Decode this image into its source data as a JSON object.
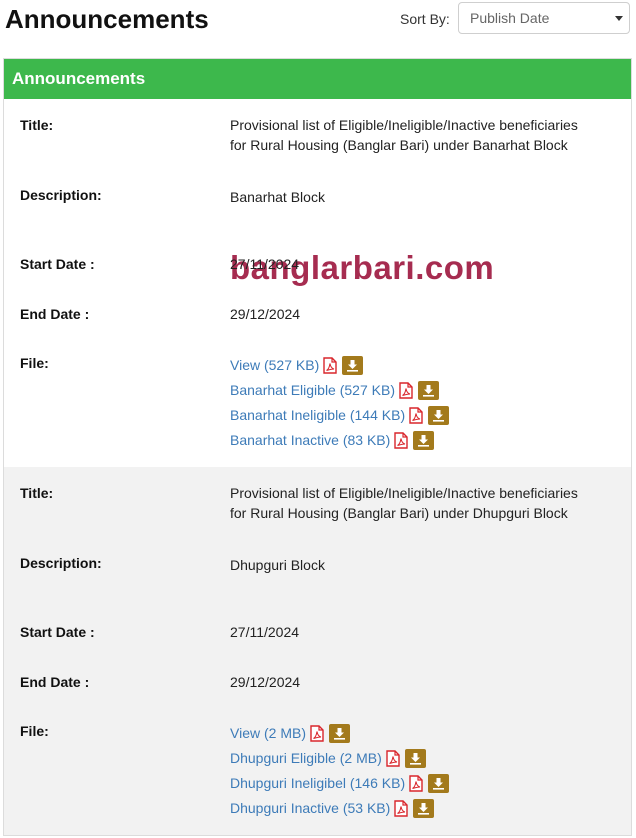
{
  "header": {
    "title": "Announcements",
    "sort_label": "Sort By:",
    "sort_value": "Publish Date"
  },
  "panel": {
    "title": "Announcements"
  },
  "labels": {
    "title": "Title:",
    "description": "Description:",
    "start_date": "Start Date :",
    "end_date": "End Date :",
    "file": "File:"
  },
  "watermark": "banglarbari.com",
  "items": [
    {
      "title_line1": "Provisional list of Eligible/Ineligible/Inactive beneficiaries",
      "title_line2": "for Rural Housing (Banglar Bari) under Banarhat Block",
      "description": "Banarhat Block",
      "start_date": "27/11/2024",
      "end_date": "29/12/2024",
      "files": [
        "View (527 KB)",
        "Banarhat Eligible (527 KB)",
        "Banarhat Ineligible (144 KB)",
        "Banarhat Inactive (83 KB)"
      ]
    },
    {
      "title_line1": "Provisional list of Eligible/Ineligible/Inactive beneficiaries",
      "title_line2": "for Rural Housing (Banglar Bari) under Dhupguri Block",
      "description": "Dhupguri Block",
      "start_date": "27/11/2024",
      "end_date": "29/12/2024",
      "files": [
        "View (2 MB)",
        "Dhupguri Eligible (2 MB)",
        "Dhupguri Ineligibel (146 KB)",
        "Dhupguri Inactive (53 KB)"
      ]
    }
  ],
  "colors": {
    "panel_header": "#3db84c",
    "alt_row": "#f2f2f2",
    "link": "#3d7bb8",
    "pdf_icon": "#d9262c",
    "download_icon": "#a37a1c",
    "watermark": "#a62c50"
  },
  "icons": {
    "pdf": "pdf-icon",
    "download": "download-icon",
    "dropdown": "chevron-down-icon"
  }
}
